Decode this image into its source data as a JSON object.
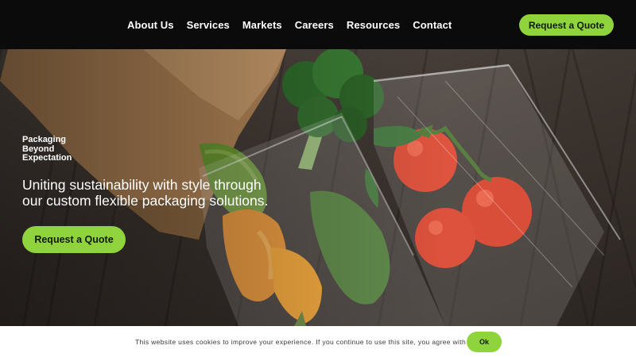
{
  "header": {
    "nav": [
      "About Us",
      "Services",
      "Markets",
      "Careers",
      "Resources",
      "Contact"
    ],
    "cta_label": "Request a Quote"
  },
  "hero": {
    "tagline": [
      "Packaging",
      "Beyond",
      "Expectation"
    ],
    "subhead": [
      "Uniting sustainability with style through",
      "our custom flexible packaging solutions."
    ],
    "cta_label": "Request a Quote",
    "image_subject": "fresh vegetables in paper bag and clear vacuum packaging on wooden table"
  },
  "cookie_bar": {
    "message": "This website uses cookies to improve your experience. If you continue to use this site, you agree with it.",
    "ok_label": "Ok"
  },
  "colors": {
    "header_bg": "#0b0b0b",
    "accent": "#8fd43c",
    "accent_text": "#0d1a05",
    "text_light": "#ffffff"
  }
}
